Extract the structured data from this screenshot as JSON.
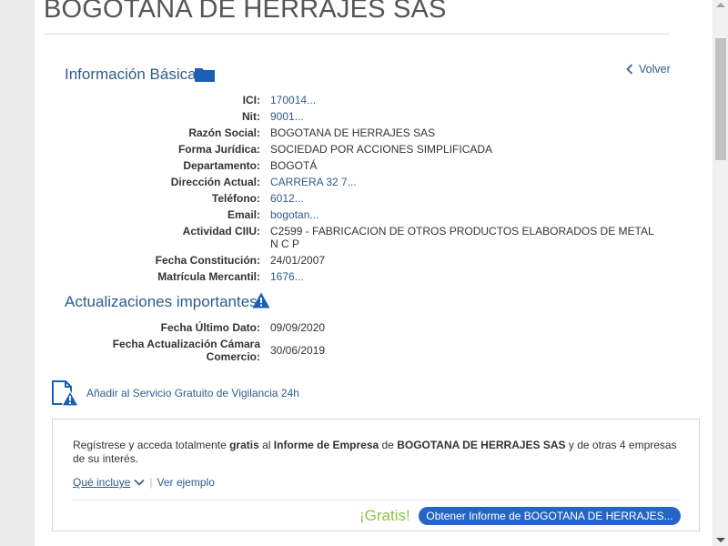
{
  "company": {
    "title": "BOGOTANA DE HERRAJES SAS"
  },
  "basic_info": {
    "heading": "Información Básica",
    "back_label": "Volver",
    "rows": [
      {
        "label": "ICI:",
        "value": "170014..."
      },
      {
        "label": "Nit:",
        "value": "9001..."
      },
      {
        "label": "Razón Social:",
        "value": "BOGOTANA DE HERRAJES SAS"
      },
      {
        "label": "Forma Jurídica:",
        "value": "SOCIEDAD POR ACCIONES SIMPLIFICADA"
      },
      {
        "label": "Departamento:",
        "value": "BOGOTÁ"
      },
      {
        "label": "Dirección Actual:",
        "value": "CARRERA 32 7..."
      },
      {
        "label": "Teléfono:",
        "value": "6012..."
      },
      {
        "label": "Email:",
        "value": "bogotan..."
      },
      {
        "label": "Actividad CIIU:",
        "value": "C2599 - FABRICACION DE OTROS PRODUCTOS ELABORADOS DE METAL N C P"
      },
      {
        "label": "Fecha Constitución:",
        "value": "24/01/2007"
      },
      {
        "label": "Matrícula Mercantil:",
        "value": "1676..."
      }
    ]
  },
  "updates": {
    "heading": "Actualizaciones importantes",
    "rows": [
      {
        "label": "Fecha Último Dato:",
        "value": "09/09/2020"
      },
      {
        "label_line1": "Fecha Actualización Cámara",
        "label_line2": "Comercio:",
        "value": "30/06/2019"
      }
    ]
  },
  "vigilancia": {
    "label": "Añadir al Servicio Gratuito de Vigilancia 24h"
  },
  "promo": {
    "text_1": "Regístrese y acceda totalmente ",
    "text_bold_1": "gratis",
    "text_2": " al ",
    "text_bold_2": "Informe de Empresa",
    "text_3": " de ",
    "text_bold_3": "BOGOTANA DE HERRAJES SAS",
    "text_4": " y de otras 4 empresas de su interés.",
    "includes_label": "Qué incluye",
    "separator": "|",
    "example_label": "Ver ejemplo",
    "gratis_label": "¡Gratis!",
    "cta_label": "Obtener Informe de BOGOTANA DE HERRAJES..."
  },
  "colors": {
    "link": "#2e5c8a",
    "cta_bg": "#2566c4",
    "gratis": "#8cc63f",
    "icon_blue": "#1a5fb4"
  },
  "icons": {
    "folder": "folder-icon",
    "warning": "warning-icon",
    "back": "chevron-left-icon",
    "document_alert": "document-alert-icon",
    "dropdown": "chevron-down-icon"
  }
}
